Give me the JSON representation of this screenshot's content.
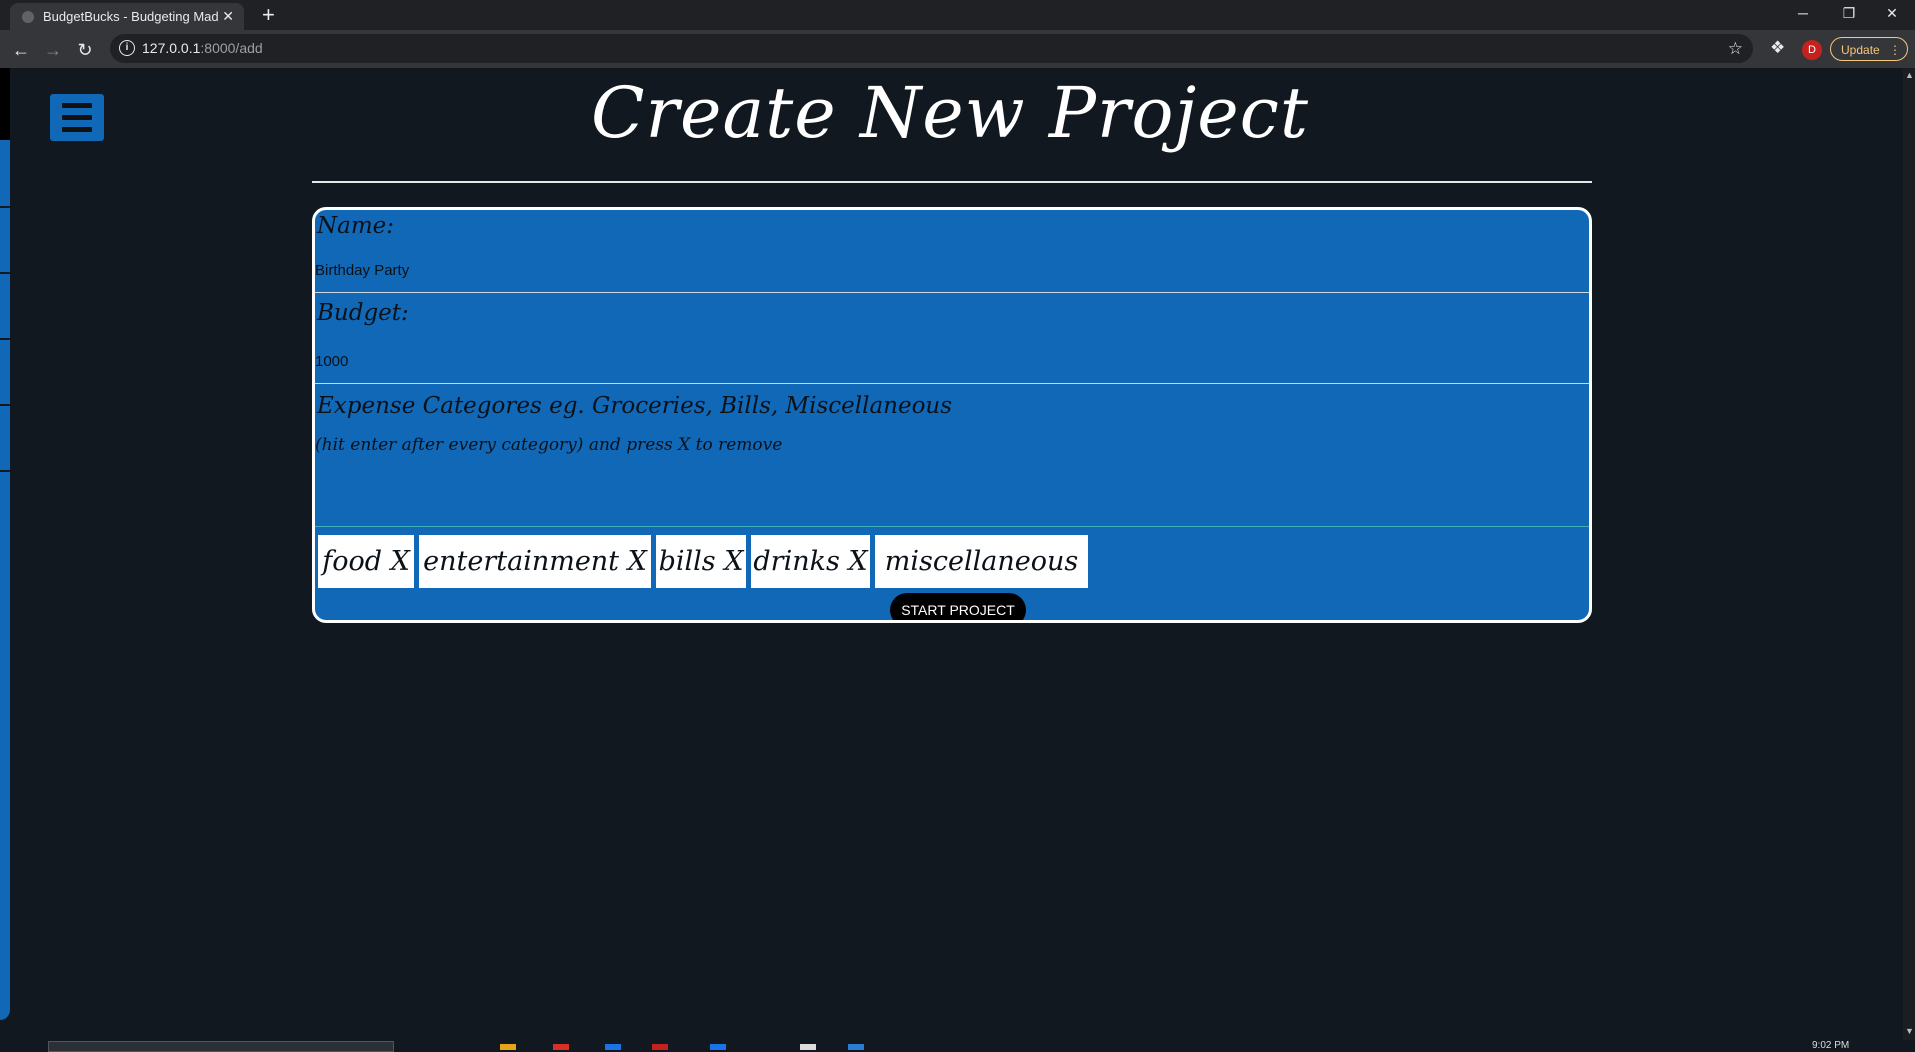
{
  "browser": {
    "tab_title": "BudgetBucks - Budgeting Made",
    "tab_close": "✕",
    "new_tab": "+",
    "url_host": "127.0.0.1",
    "url_path": ":8000/add",
    "update_label": "Update",
    "profile_initial": "D",
    "window_controls": {
      "minimize": "─",
      "restore": "❐",
      "close": "✕"
    }
  },
  "page": {
    "title": "Create New Project",
    "menu_icon": "hamburger-icon"
  },
  "form": {
    "name_label": "Name:",
    "name_value": "Birthday Party",
    "budget_label": "Budget:",
    "budget_value": "1000",
    "categories_label": "Expense Categores eg. Groceries, Bills, Miscellaneous",
    "categories_hint": "(hit enter after every category) and press X to remove",
    "categories": [
      {
        "label": "food X"
      },
      {
        "label": "entertainment X"
      },
      {
        "label": "bills X"
      },
      {
        "label": "drinks X"
      },
      {
        "label": "miscellaneous X"
      }
    ],
    "submit_label": "START PROJECT"
  },
  "taskbar": {
    "clock": "9:02 PM"
  },
  "colors": {
    "background": "#111820",
    "accent_blue": "#1168b6",
    "update_yellow": "#f2c879"
  }
}
